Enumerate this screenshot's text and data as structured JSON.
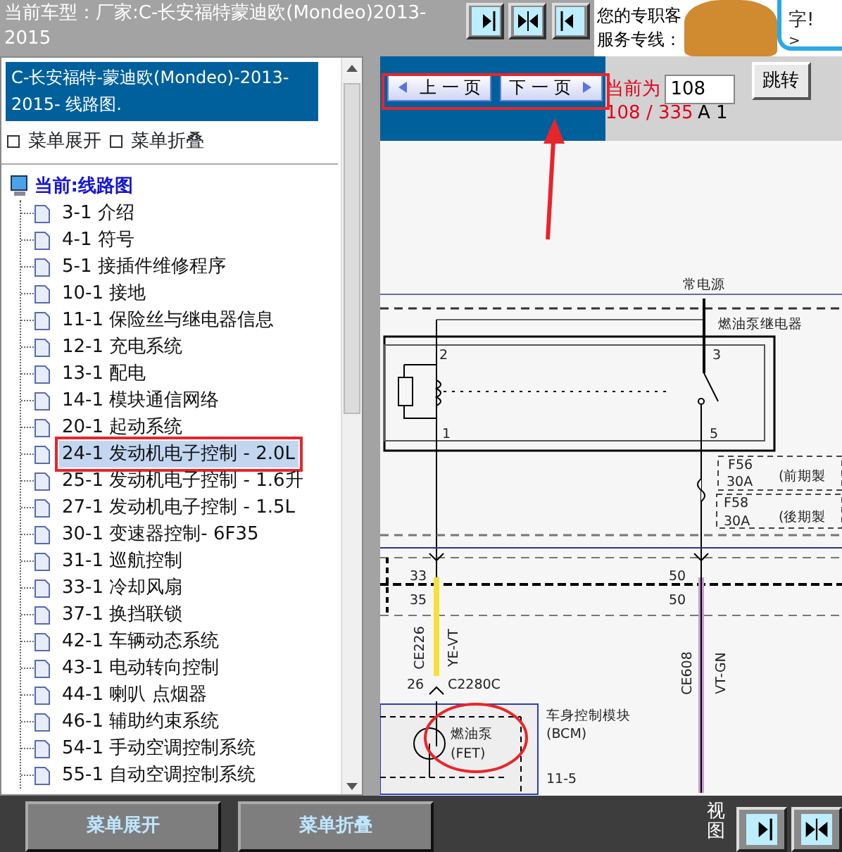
{
  "header": {
    "title": "当前车型：厂家:C-长安福特蒙迪欧(Mondeo)2013-2015",
    "view_buttons": [
      {
        "kind": "right"
      },
      {
        "kind": "both"
      },
      {
        "kind": "left"
      }
    ],
    "ad_lines": [
      "您的专职客",
      "服务专线："
    ],
    "bubble_text": "字!",
    "bubble_link": ">"
  },
  "sidebar": {
    "heading": "C-长安福特-蒙迪欧(Mondeo)-2013-2015- 线路图.",
    "expand": "菜单展开",
    "collapse": "菜单折叠",
    "root": "当前:线路图",
    "items": [
      {
        "label": "3-1 介绍",
        "selected": false
      },
      {
        "label": "4-1 符号",
        "selected": false
      },
      {
        "label": "5-1 接插件维修程序",
        "selected": false
      },
      {
        "label": "10-1 接地",
        "selected": false
      },
      {
        "label": "11-1 保险丝与继电器信息",
        "selected": false
      },
      {
        "label": "12-1 充电系统",
        "selected": false
      },
      {
        "label": "13-1 配电",
        "selected": false
      },
      {
        "label": "14-1 模块通信网络",
        "selected": false
      },
      {
        "label": "20-1 起动系统",
        "selected": false
      },
      {
        "label": "24-1 发动机电子控制 - 2.0L",
        "selected": true
      },
      {
        "label": "25-1 发动机电子控制 - 1.6升",
        "selected": false
      },
      {
        "label": "27-1 发动机电子控制 - 1.5L",
        "selected": false
      },
      {
        "label": "30-1 变速器控制- 6F35",
        "selected": false
      },
      {
        "label": "31-1 巡航控制",
        "selected": false
      },
      {
        "label": "33-1 冷却风扇",
        "selected": false
      },
      {
        "label": "37-1 换挡联锁",
        "selected": false
      },
      {
        "label": "42-1 车辆动态系统",
        "selected": false
      },
      {
        "label": "43-1 电动转向控制",
        "selected": false
      },
      {
        "label": "44-1 喇叭 点烟器",
        "selected": false
      },
      {
        "label": "46-1 辅助约束系统",
        "selected": false
      },
      {
        "label": "54-1 手动空调控制系统",
        "selected": false
      },
      {
        "label": "55-1 自动空调控制系统",
        "selected": false
      }
    ]
  },
  "pager": {
    "prev": "上 一 页",
    "next": "下 一 页",
    "current_label": "当前为",
    "page_value": "108",
    "jump": "跳转",
    "page_count": "108 / 335",
    "sheet": "A 1"
  },
  "diagram": {
    "labels": [
      "常电源",
      "燃油泵继电器",
      "2",
      "3",
      "1",
      "5",
      "F56",
      "30A",
      "(前期製",
      "F58",
      "30A",
      "(後期製",
      "33",
      "35",
      "50",
      "50",
      "CE226",
      "YE-VT",
      "26",
      "C2280C",
      "CE608",
      "VT-GN",
      "车身控制模块",
      "(BCM)",
      "燃油泵",
      "(FET)",
      "11-5"
    ]
  },
  "footer": {
    "expand": "菜单展开",
    "collapse": "菜单折叠",
    "view_label": "视图",
    "view_buttons": [
      {
        "kind": "right"
      },
      {
        "kind": "both"
      }
    ]
  }
}
